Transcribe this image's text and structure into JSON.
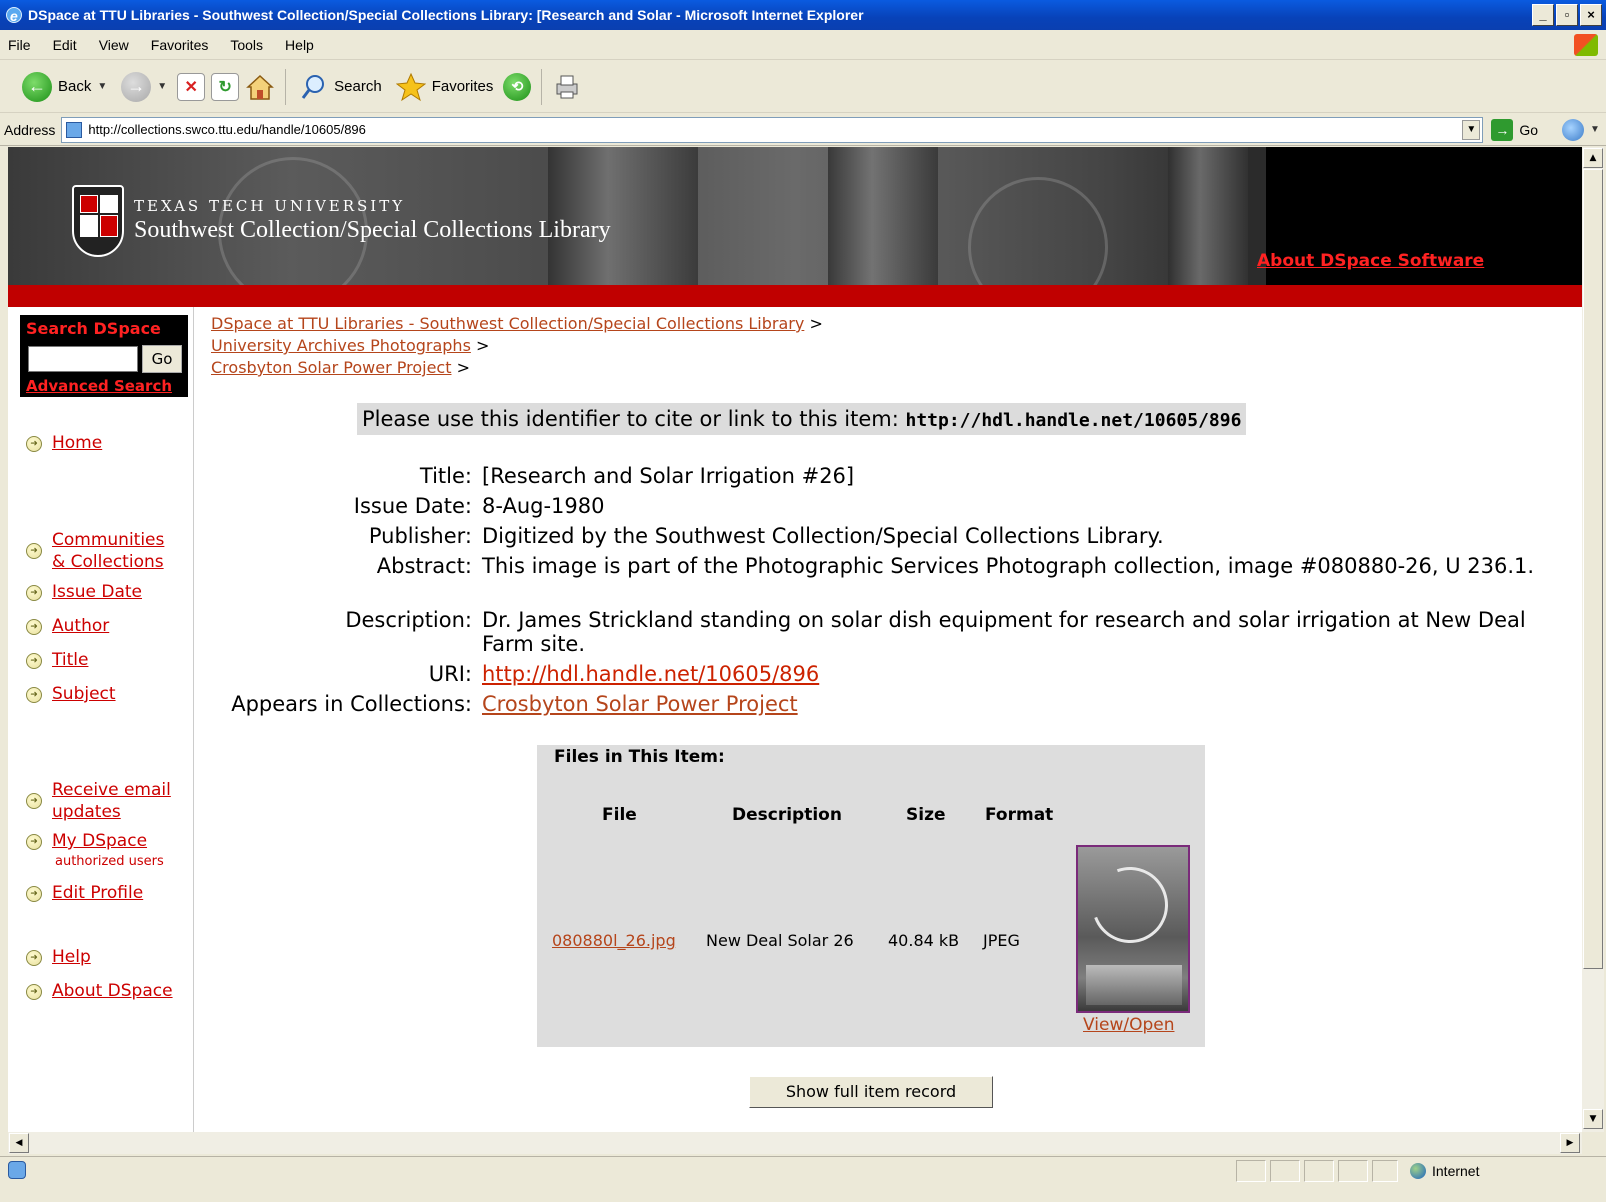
{
  "window": {
    "title": "DSpace at TTU Libraries - Southwest Collection/Special Collections Library: [Research and Solar - Microsoft Internet Explorer"
  },
  "menu": [
    "File",
    "Edit",
    "View",
    "Favorites",
    "Tools",
    "Help"
  ],
  "toolbar": {
    "back": "Back",
    "search": "Search",
    "favorites": "Favorites"
  },
  "address": {
    "label": "Address",
    "url": "http://collections.swco.ttu.edu/handle/10605/896",
    "go": "Go"
  },
  "banner": {
    "university": "TEXAS TECH UNIVERSITY",
    "library": "Southwest Collection/Special Collections Library",
    "about_link": "About DSpace Software"
  },
  "sidebar": {
    "search_label": "Search DSpace",
    "go": "Go",
    "advanced": "Advanced Search",
    "items": [
      {
        "label": "Home"
      },
      {
        "label": "Communities"
      },
      {
        "label": "& Collections"
      },
      {
        "label": "Issue Date"
      },
      {
        "label": "Author"
      },
      {
        "label": "Title"
      },
      {
        "label": "Subject"
      },
      {
        "label": "Receive email"
      },
      {
        "label": "updates"
      },
      {
        "label": "My DSpace"
      },
      {
        "label": "Edit Profile"
      },
      {
        "label": "Help"
      },
      {
        "label": "About DSpace"
      }
    ],
    "authorized": "authorized users"
  },
  "breadcrumbs": [
    "DSpace at TTU Libraries - Southwest Collection/Special Collections Library",
    "University Archives Photographs",
    "Crosbyton Solar Power Project"
  ],
  "breadcrumb_sep": ">",
  "identifier": {
    "text": "Please use this identifier to cite or link to this item:",
    "handle": "http://hdl.handle.net/10605/896"
  },
  "metadata": {
    "title_k": "Title:",
    "title_v": "[Research and Solar Irrigation #26]",
    "date_k": "Issue Date:",
    "date_v": "8-Aug-1980",
    "pub_k": "Publisher:",
    "pub_v": "Digitized by the Southwest Collection/Special Collections Library.",
    "abs_k": "Abstract:",
    "abs_v": "This image is part of the Photographic Services Photograph collection, image #080880-26, U 236.1.",
    "desc_k": "Description:",
    "desc_v": "Dr. James Strickland standing on solar dish equipment for research and solar irrigation at New Deal Farm site.",
    "uri_k": "URI:",
    "uri_v": "http://hdl.handle.net/10605/896",
    "coll_k": "Appears in Collections:",
    "coll_v": "Crosbyton Solar Power Project"
  },
  "files": {
    "title": "Files in This Item:",
    "headers": [
      "File",
      "Description",
      "Size",
      "Format"
    ],
    "row": {
      "file": "080880l_26.jpg",
      "description": "New Deal Solar 26",
      "size": "40.84 kB",
      "format": "JPEG"
    },
    "view": "View/Open"
  },
  "show_full": "Show full item record",
  "status": {
    "zone": "Internet"
  }
}
